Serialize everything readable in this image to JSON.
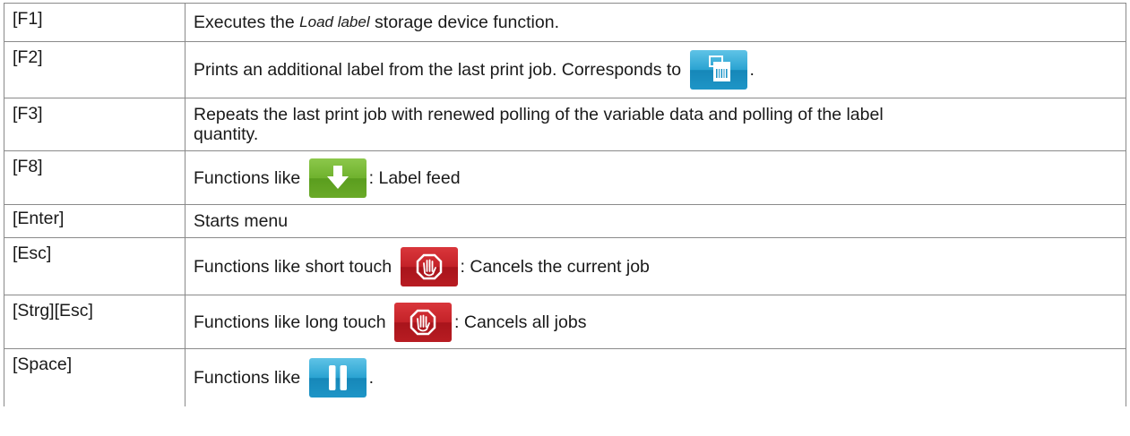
{
  "rows": [
    {
      "key": "[F1]",
      "desc_pre": "Executes the ",
      "desc_italic": "Load label",
      "desc_post": " storage device function."
    },
    {
      "key": "[F2]",
      "desc_pre": "Prints an additional label from the last print job. Corresponds to ",
      "icon": "print-label-icon",
      "desc_post": "."
    },
    {
      "key": "[F3]",
      "desc_line1": "Repeats the last print job with renewed polling of the variable data and polling of the label",
      "desc_line2": "quantity."
    },
    {
      "key": "[F8]",
      "desc_pre": "Functions like ",
      "icon": "label-feed-arrow-icon",
      "desc_post": ": Label feed"
    },
    {
      "key": "[Enter]",
      "desc": "Starts menu"
    },
    {
      "key": "[Esc]",
      "desc_pre": "Functions like short touch ",
      "icon": "stop-hand-icon",
      "desc_post": ": Cancels the current job"
    },
    {
      "key": "[Strg][Esc]",
      "desc_pre": "Functions like long touch ",
      "icon": "stop-hand-icon",
      "desc_post": ": Cancels all jobs"
    },
    {
      "key": "[Space]",
      "desc_pre": "Functions like ",
      "icon": "pause-icon",
      "desc_post": "."
    }
  ],
  "colors": {
    "blue": "#1e95c7",
    "green": "#6aaa28",
    "red": "#b81c22",
    "border": "#8a8a8a"
  }
}
